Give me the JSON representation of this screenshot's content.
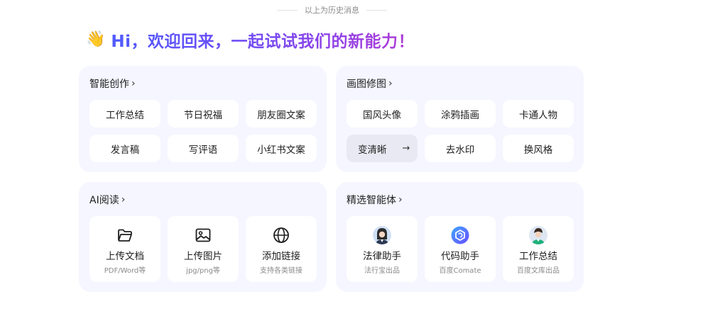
{
  "history_label": "以上为历史消息",
  "greeting": {
    "emoji": "👋",
    "text": "Hi，欢迎回来，一起试试我们的新能力！"
  },
  "cards": {
    "writing": {
      "title": "智能创作",
      "chips": [
        "工作总结",
        "节日祝福",
        "朋友圈文案",
        "发言稿",
        "写评语",
        "小红书文案"
      ]
    },
    "image": {
      "title": "画图修图",
      "chips": [
        "国风头像",
        "涂鸦插画",
        "卡通人物",
        "变清晰",
        "去水印",
        "换风格"
      ],
      "active_arrow": "→"
    },
    "reading": {
      "title": "AI阅读",
      "tiles": [
        {
          "label": "上传文档",
          "sub": "PDF/Word等",
          "icon": "folder-icon"
        },
        {
          "label": "上传图片",
          "sub": "jpg/png等",
          "icon": "image-icon"
        },
        {
          "label": "添加链接",
          "sub": "支持各类链接",
          "icon": "globe-icon"
        }
      ]
    },
    "agents": {
      "title": "精选智能体",
      "tiles": [
        {
          "label": "法律助手",
          "sub": "法行宝出品",
          "icon": "lawyer-avatar-icon"
        },
        {
          "label": "代码助手",
          "sub": "百度Comate",
          "icon": "comate-logo-icon"
        },
        {
          "label": "工作总结",
          "sub": "百度文库出品",
          "icon": "worker-avatar-icon"
        }
      ]
    }
  },
  "chevron": "›"
}
